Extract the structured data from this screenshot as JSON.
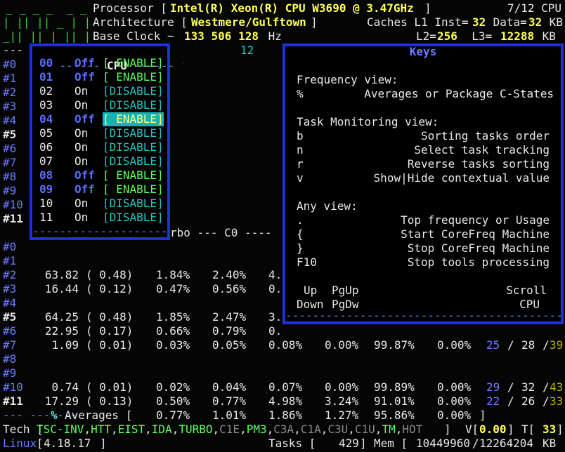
{
  "header": {
    "meter_l1": "_ _ _ _  _ _",
    "meter_l2": "| || || _ | |",
    "meter_l3": "_|| || | || |",
    "processor_label": "Processor [",
    "processor_value": "Intel(R) Xeon(R) CPU W3690 @ 3.47GHz",
    "processor_close": "]",
    "cpu_count": "7/12 CPU",
    "architecture_label": "Architecture [",
    "architecture_value": "Westmere/Gulftown",
    "architecture_close": "]",
    "caches_label": "Caches L1 Inst=",
    "l1_inst": "32",
    "data_label": " Data=",
    "l1_data": "32",
    "kb": " KB",
    "base_clock_label": "Base Clock ~ ",
    "base_clock_value": "133 506 128",
    "hz": " Hz",
    "l2_label": "L2=",
    "l2": "256",
    "l3_label": "  L3=",
    "l3": "12288",
    "l3_unit": " KB"
  },
  "separator_top": "---",
  "separator_mid": "12",
  "cpu_window": {
    "title": "CPU",
    "rows": [
      {
        "id": "00",
        "state": "Off",
        "action": "[ ENABLE]"
      },
      {
        "id": "01",
        "state": "Off",
        "action": "[ ENABLE]"
      },
      {
        "id": "02",
        "state": "On",
        "action": "[DISABLE]"
      },
      {
        "id": "03",
        "state": "On",
        "action": "[DISABLE]"
      },
      {
        "id": "04",
        "state": "Off",
        "action": "[ ENABLE]"
      },
      {
        "id": "05",
        "state": "On",
        "action": "[DISABLE]"
      },
      {
        "id": "06",
        "state": "On",
        "action": "[DISABLE]"
      },
      {
        "id": "07",
        "state": "On",
        "action": "[DISABLE]"
      },
      {
        "id": "08",
        "state": "Off",
        "action": "[ ENABLE]"
      },
      {
        "id": "09",
        "state": "Off",
        "action": "[ ENABLE]"
      },
      {
        "id": "10",
        "state": "On",
        "action": "[DISABLE]"
      },
      {
        "id": "11",
        "state": "On",
        "action": "[DISABLE]"
      }
    ]
  },
  "keys_window": {
    "title": "Keys",
    "freq_view": "Frequency view:",
    "freq_key": "%",
    "freq_desc": "Averages or Package C-States",
    "task_view": "Task Monitoring view:",
    "task_keys": [
      {
        "key": "b",
        "desc": "Sorting tasks order"
      },
      {
        "key": "n",
        "desc": "Select task tracking"
      },
      {
        "key": "r",
        "desc": "Reverse tasks sorting"
      },
      {
        "key": "v",
        "desc": "Show|Hide contextual value"
      }
    ],
    "any_view": "Any view:",
    "any_keys": [
      {
        "key": ".",
        "desc": "Top frequency or Usage"
      },
      {
        "key": "{",
        "desc": "Start CoreFreq Machine"
      },
      {
        "key": "}",
        "desc": "Stop CoreFreq Machine"
      },
      {
        "key": "F10",
        "desc": "Stop tools processing"
      }
    ],
    "scroll_up_key": "Up",
    "scroll_up_key2": "PgUp",
    "scroll_down_key": "Down",
    "scroll_down_key2": "PgDw",
    "scroll_label": "Scroll",
    "scroll_label2": "CPU"
  },
  "top_labels": [
    "#0",
    "#1",
    "#2",
    "#3",
    "#4",
    "#5",
    "#6",
    "#7",
    "#8",
    "#9",
    "#10",
    "#11"
  ],
  "freq_header": "rbo --- C0 ----",
  "freq_rows": [
    {
      "cpu": "#0"
    },
    {
      "cpu": "#1"
    },
    {
      "cpu": "#2",
      "freq": "63.82",
      "ratio": "( 0.48)",
      "turbo": "1.84%",
      "c0": "2.40%",
      "c1": "4."
    },
    {
      "cpu": "#3",
      "freq": "16.44",
      "ratio": "( 0.12)",
      "turbo": "0.47%",
      "c0": "0.56%",
      "c1": "0."
    },
    {
      "cpu": "#4"
    },
    {
      "cpu": "#5",
      "freq": "64.25",
      "ratio": "( 0.48)",
      "turbo": "1.85%",
      "c0": "2.47%",
      "c1": "3."
    },
    {
      "cpu": "#6",
      "freq": "22.95",
      "ratio": "( 0.17)",
      "turbo": "0.66%",
      "c0": "0.79%",
      "c1": "0."
    },
    {
      "cpu": "#7",
      "freq": "1.09",
      "ratio": "( 0.01)",
      "turbo": "0.03%",
      "c0": "0.05%",
      "c1": "0.08%",
      "c3": "0.00%",
      "c6": "99.87%",
      "c7": "0.00%",
      "tmin": "25",
      "tcur": "28",
      "tmax": "39"
    },
    {
      "cpu": "#8"
    },
    {
      "cpu": "#9"
    },
    {
      "cpu": "#10",
      "freq": "0.74",
      "ratio": "( 0.01)",
      "turbo": "0.02%",
      "c0": "0.04%",
      "c1": "0.07%",
      "c3": "0.00%",
      "c6": "99.89%",
      "c7": "0.00%",
      "tmin": "29",
      "tcur": "32",
      "tmax": "43"
    },
    {
      "cpu": "#11",
      "freq": "17.29",
      "ratio": "( 0.13)",
      "turbo": "0.50%",
      "c0": "0.77%",
      "c1": "4.98%",
      "c3": "3.24%",
      "c6": "91.01%",
      "c7": "0.00%",
      "tmin": "22",
      "tcur": "26",
      "tmax": "33"
    }
  ],
  "averages": {
    "key": "%",
    "label": "Averages [",
    "turbo": "0.77%",
    "c0": "1.01%",
    "c1": "1.86%",
    "c3": "1.27%",
    "c6": "95.86%",
    "c7": "0.00%",
    "close": "]"
  },
  "tech": {
    "label": "Tech [",
    "flags": [
      {
        "t": "TSC-INV",
        "on": true
      },
      {
        "t": "HTT",
        "on": true
      },
      {
        "t": "EIST",
        "on": true
      },
      {
        "t": "IDA",
        "on": true
      },
      {
        "t": "TURBO",
        "on": true
      },
      {
        "t": "C1E",
        "on": false
      },
      {
        "t": "PM3",
        "on": true
      },
      {
        "t": "C3A",
        "on": false
      },
      {
        "t": "C1A",
        "on": false
      },
      {
        "t": "C3U",
        "on": false
      },
      {
        "t": "C1U",
        "on": false
      },
      {
        "t": "TM",
        "on": true
      },
      {
        "t": "HOT",
        "on": false
      }
    ],
    "close": "]",
    "v_label": "V[",
    "v_value": "0.00",
    "v_close": "]",
    "t_label": "T[",
    "t_value": "33",
    "t_close": "]"
  },
  "footer": {
    "os": "Linux",
    "kernel": "4.18.17",
    "tasks_label": "Tasks [",
    "tasks_value": "429",
    "mem_label": "Mem [",
    "mem_used": "10449960",
    "mem_total": "12264204",
    "mem_unit": "KB"
  },
  "colors": {
    "window_border": "#1f2fe0",
    "highlight": "#15b3b3"
  }
}
